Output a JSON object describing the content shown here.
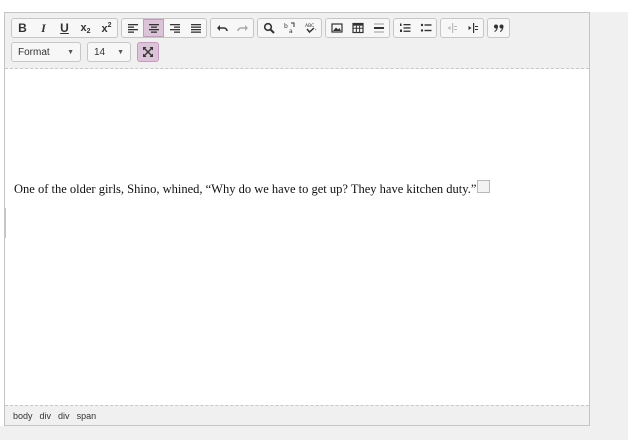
{
  "toolbar": {
    "row1": [
      {
        "group": "text-style",
        "buttons": [
          {
            "name": "bold-button",
            "label": "B"
          },
          {
            "name": "italic-button",
            "label": "I"
          },
          {
            "name": "underline-button",
            "label": "U"
          },
          {
            "name": "subscript-button",
            "label": "x",
            "sub": "2"
          },
          {
            "name": "superscript-button",
            "label": "x",
            "sup": "2"
          }
        ]
      },
      {
        "group": "alignment",
        "buttons": [
          {
            "name": "align-left-button",
            "icon": "align-left-icon"
          },
          {
            "name": "align-center-button",
            "icon": "align-center-icon",
            "active": true
          },
          {
            "name": "align-right-button",
            "icon": "align-right-icon"
          },
          {
            "name": "align-justify-button",
            "icon": "align-justify-icon"
          }
        ]
      },
      {
        "group": "history",
        "buttons": [
          {
            "name": "undo-button",
            "icon": "undo-icon"
          },
          {
            "name": "redo-button",
            "icon": "redo-icon"
          }
        ]
      },
      {
        "group": "search",
        "buttons": [
          {
            "name": "find-button",
            "icon": "search-icon"
          },
          {
            "name": "replace-button",
            "icon": "find-replace-icon"
          },
          {
            "name": "spellcheck-button",
            "icon": "spellcheck-icon"
          }
        ]
      },
      {
        "group": "insert",
        "buttons": [
          {
            "name": "image-button",
            "icon": "image-icon"
          },
          {
            "name": "table-button",
            "icon": "table-icon"
          },
          {
            "name": "horizontal-rule-button",
            "icon": "horizontal-rule-icon"
          }
        ]
      },
      {
        "group": "lists",
        "buttons": [
          {
            "name": "numbered-list-button",
            "icon": "numbered-list-icon"
          },
          {
            "name": "bullet-list-button",
            "icon": "bullet-list-icon"
          }
        ]
      },
      {
        "group": "indent",
        "buttons": [
          {
            "name": "outdent-button",
            "icon": "outdent-icon"
          },
          {
            "name": "indent-button",
            "icon": "indent-icon"
          }
        ]
      },
      {
        "group": "quote",
        "buttons": [
          {
            "name": "blockquote-button",
            "icon": "blockquote-icon"
          }
        ]
      }
    ],
    "format_select": {
      "value": "Format"
    },
    "size_select": {
      "value": "14"
    },
    "fullscreen": {
      "icon": "fullscreen-icon",
      "active": true
    }
  },
  "content": {
    "paragraph": "One of the older girls, Shino, whined, “Why do we have to get up? They have kitchen duty.”"
  },
  "statusbar": {
    "path": [
      "body",
      "div",
      "div",
      "span"
    ]
  },
  "colors": {
    "toolbar_bg": "#f0f0f0",
    "active_button": "#dcc4d8",
    "border": "#c5c5c5"
  }
}
